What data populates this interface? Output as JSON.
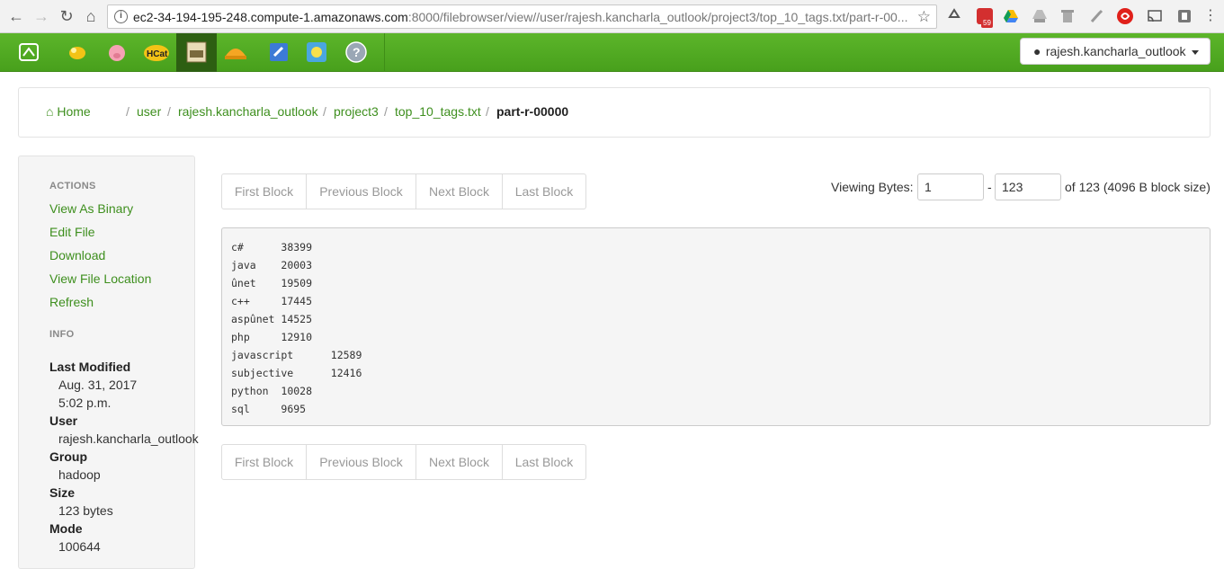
{
  "browser": {
    "url_host": "ec2-34-194-195-248.compute-1.amazonaws.com",
    "url_rest": ":8000/filebrowser/view//user/rajesh.kancharla_outlook/project3/top_10_tags.txt/part-r-00...",
    "ext_badge": "59"
  },
  "user_menu": {
    "label": "rajesh.kancharla_outlook"
  },
  "breadcrumb": {
    "home": "Home",
    "items": [
      "user",
      "rajesh.kancharla_outlook",
      "project3",
      "top_10_tags.txt"
    ],
    "current": "part-r-00000",
    "sep": "/"
  },
  "sidebar": {
    "actions_heading": "ACTIONS",
    "actions": [
      "View As Binary",
      "Edit File",
      "Download",
      "View File Location",
      "Refresh"
    ],
    "info_heading": "INFO",
    "info": {
      "last_modified_label": "Last Modified",
      "last_modified_date": "Aug. 31, 2017",
      "last_modified_time": "5:02 p.m.",
      "user_label": "User",
      "user": "rajesh.kancharla_outlook",
      "group_label": "Group",
      "group": "hadoop",
      "size_label": "Size",
      "size": "123 bytes",
      "mode_label": "Mode",
      "mode": "100644"
    }
  },
  "pager": {
    "first": "First Block",
    "previous": "Previous Block",
    "next": "Next Block",
    "last": "Last Block"
  },
  "viewing": {
    "label": "Viewing Bytes:",
    "start": "1",
    "dash": "-",
    "end": "123",
    "suffix": "of 123 (4096 B block size)"
  },
  "file_content": "c#\t38399\njava\t20003\nûnet\t19509\nc++\t17445\naspûnet\t14525\nphp\t12910\njavascript\t12589\nsubjective\t12416\npython\t10028\nsql\t9695"
}
